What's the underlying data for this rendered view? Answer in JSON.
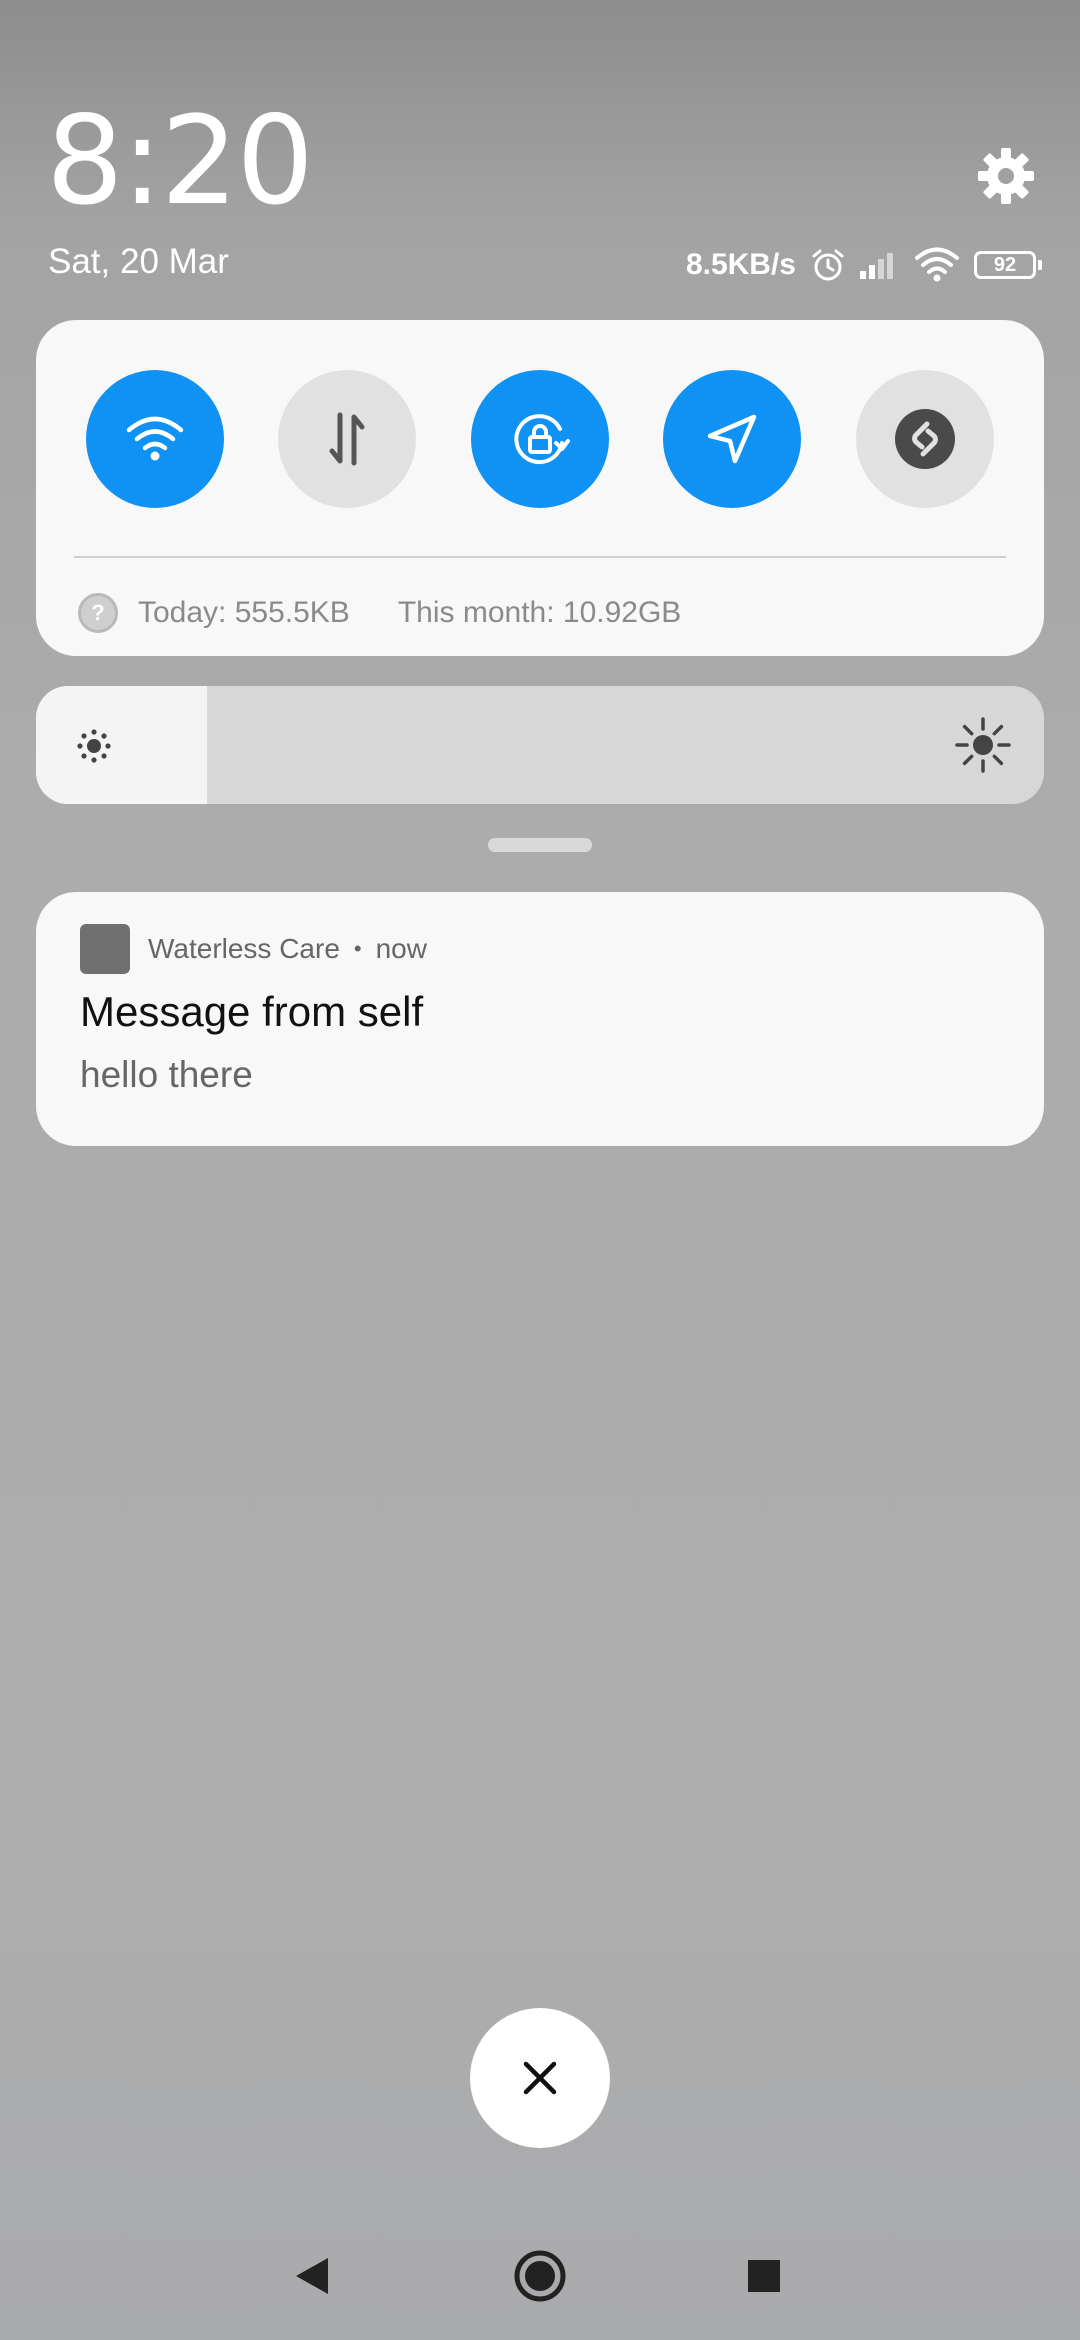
{
  "clock": {
    "time": "8:20",
    "date": "Sat, 20 Mar"
  },
  "status_bar": {
    "network_speed": "8.5KB/s",
    "battery_level": "92"
  },
  "quick_settings": {
    "tiles": [
      {
        "icon": "wifi-icon",
        "state": "on"
      },
      {
        "icon": "mobile-data-icon",
        "state": "off"
      },
      {
        "icon": "rotation-lock-icon",
        "state": "on"
      },
      {
        "icon": "location-icon",
        "state": "on"
      },
      {
        "icon": "shazam-icon",
        "state": "off"
      }
    ],
    "data_usage": {
      "today": "Today: 555.5KB",
      "month": "This month: 10.92GB"
    }
  },
  "brightness": {
    "level": 0.17
  },
  "notification": {
    "app_name": "Waterless Care",
    "time": "now",
    "title": "Message from self",
    "body": "hello there"
  },
  "colors": {
    "accent": "#0f92f4",
    "card": "#f8f8f8",
    "tile_off": "#e1e1e1"
  }
}
